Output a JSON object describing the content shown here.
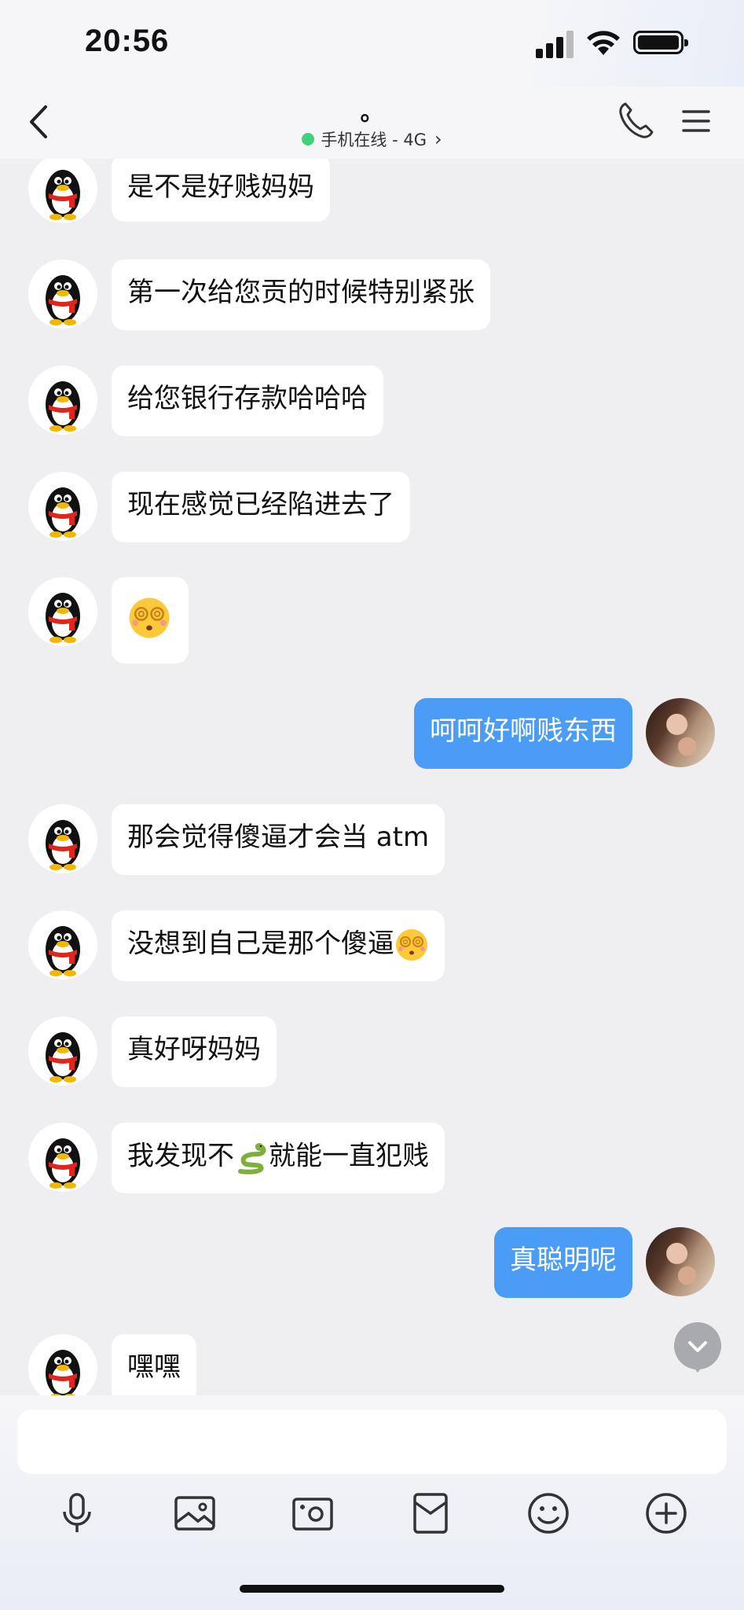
{
  "status": {
    "time": "20:56"
  },
  "header": {
    "title": "。",
    "status_text": "手机在线 - 4G"
  },
  "messages": [
    {
      "side": "in",
      "text": "是不是好贱妈妈"
    },
    {
      "side": "in",
      "text": "第一次给您贡的时候特别紧张"
    },
    {
      "side": "in",
      "text": "给您银行存款哈哈哈"
    },
    {
      "side": "in",
      "text": "现在感觉已经陷进去了"
    },
    {
      "side": "in",
      "text": "",
      "emoji": "dizzy-face"
    },
    {
      "side": "out",
      "text": "呵呵好啊贱东西"
    },
    {
      "side": "in",
      "text": "那会觉得傻逼才会当 atm"
    },
    {
      "side": "in",
      "text": "没想到自己是那个傻逼",
      "emoji": "dizzy-face"
    },
    {
      "side": "in",
      "text": "真好呀妈妈"
    },
    {
      "side": "in",
      "text_before": "我发现不",
      "emoji": "snake",
      "text_after": "就能一直犯贱"
    },
    {
      "side": "out",
      "text": "真聪明呢"
    },
    {
      "side": "in",
      "text": "嘿嘿"
    }
  ],
  "input": {
    "placeholder": ""
  },
  "toolbar": [
    "microphone-icon",
    "image-icon",
    "camera-icon",
    "red-packet-icon",
    "emoji-icon",
    "plus-icon"
  ],
  "colors": {
    "accent": "#4a9cf5",
    "online": "#3fd27a",
    "background": "#efeff2"
  }
}
